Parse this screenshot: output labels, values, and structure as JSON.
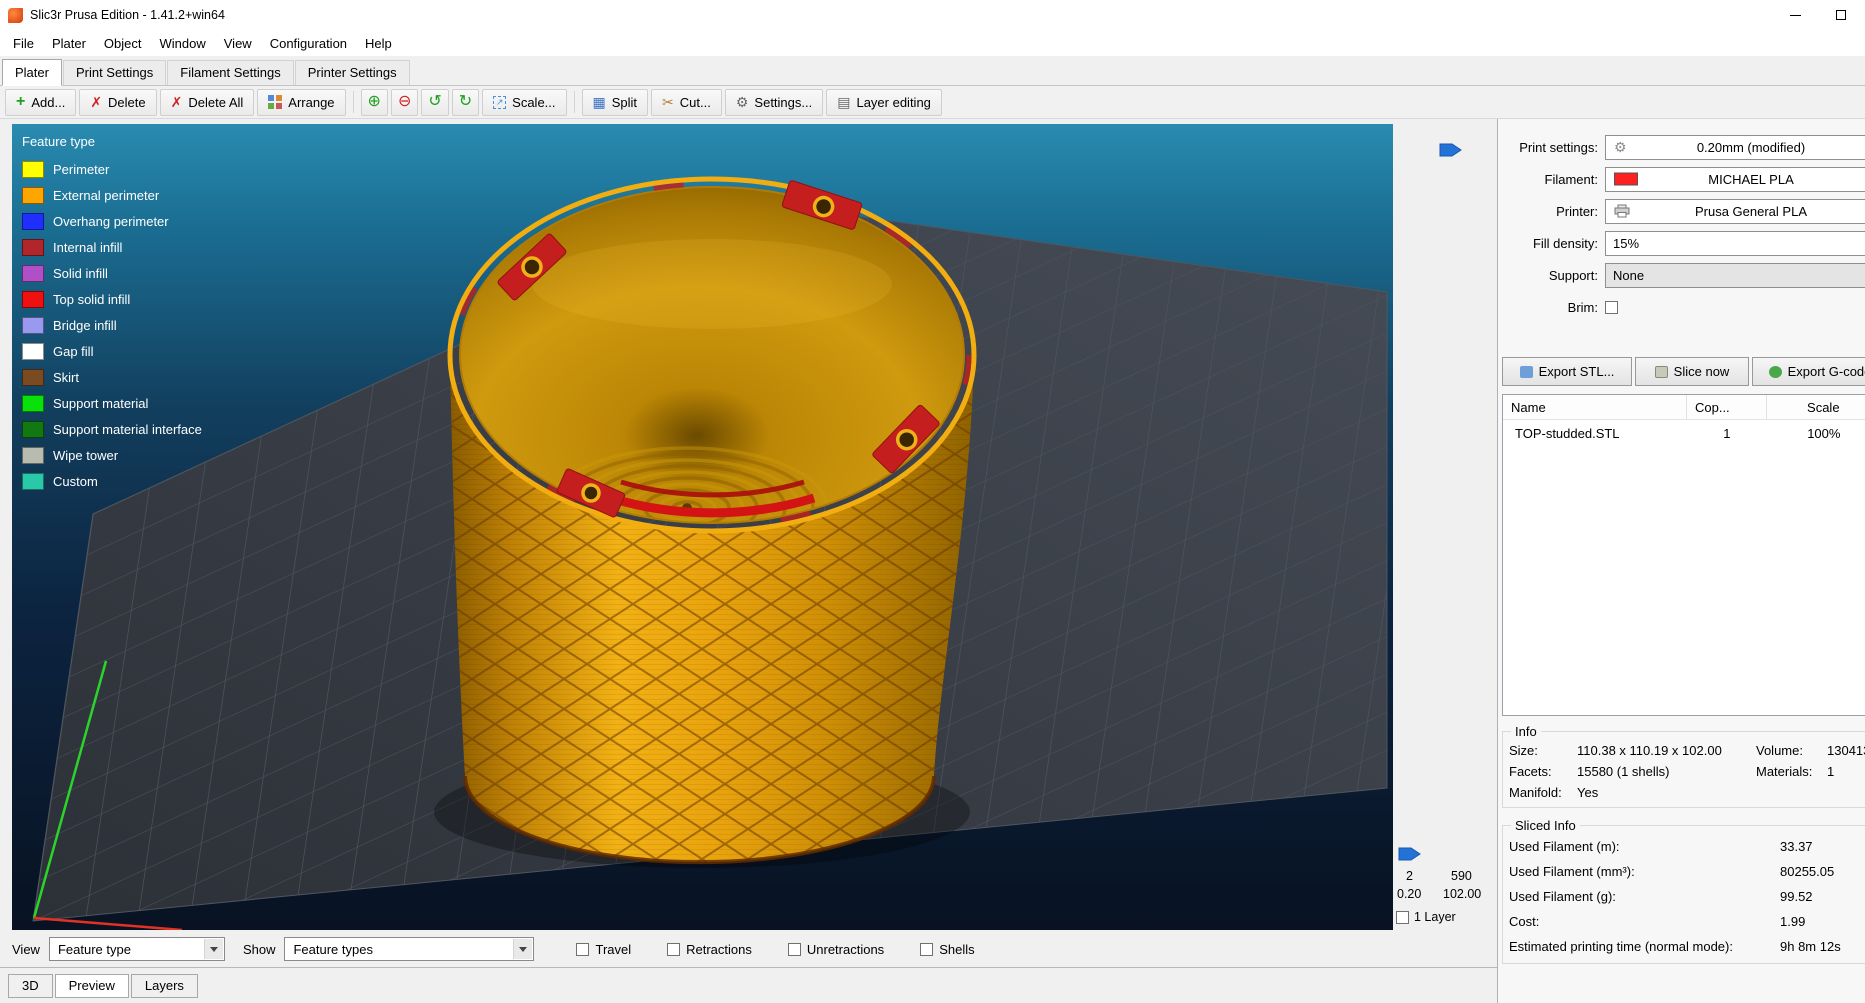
{
  "window": {
    "title": "Slic3r Prusa Edition - 1.41.2+win64"
  },
  "menubar": {
    "items": [
      "File",
      "Plater",
      "Object",
      "Window",
      "View",
      "Configuration",
      "Help"
    ]
  },
  "tabbar": {
    "items": [
      "Plater",
      "Print Settings",
      "Filament Settings",
      "Printer Settings"
    ],
    "active": "Plater"
  },
  "toolbar": {
    "add": "Add...",
    "delete": "Delete",
    "delete_all": "Delete All",
    "arrange": "Arrange",
    "scale": "Scale...",
    "split": "Split",
    "cut": "Cut...",
    "settings": "Settings...",
    "layer_editing": "Layer editing"
  },
  "icons": {
    "add_plus": "+",
    "delete_x": "✗",
    "add_instance": "⊕",
    "remove_instance": "⊖",
    "rotate_ccw": "↺",
    "rotate_cw": "↻",
    "scale_arrow": "↗",
    "split_grid": "▦",
    "cut_scissors": "✂",
    "gear": "⚙",
    "layers": "▤"
  },
  "legend": {
    "title": "Feature type",
    "items": [
      {
        "label": "Perimeter",
        "color": "#FFFF00"
      },
      {
        "label": "External perimeter",
        "color": "#FFA500"
      },
      {
        "label": "Overhang perimeter",
        "color": "#1F2FFF"
      },
      {
        "label": "Internal infill",
        "color": "#B0262B"
      },
      {
        "label": "Solid infill",
        "color": "#B050C8"
      },
      {
        "label": "Top solid infill",
        "color": "#F01010"
      },
      {
        "label": "Bridge infill",
        "color": "#9999F0"
      },
      {
        "label": "Gap fill",
        "color": "#FFFFFF"
      },
      {
        "label": "Skirt",
        "color": "#7A4B20"
      },
      {
        "label": "Support material",
        "color": "#0AE00A"
      },
      {
        "label": "Support material interface",
        "color": "#127812"
      },
      {
        "label": "Wipe tower",
        "color": "#B7BCAE"
      },
      {
        "label": "Custom",
        "color": "#28C8A8"
      }
    ]
  },
  "slider": {
    "min_layer": "2",
    "max_layer": "590",
    "min_z": "0.20",
    "max_z": "102.00",
    "one_layer_label": "1 Layer"
  },
  "sidebar": {
    "print_settings_label": "Print settings:",
    "print_settings_value": "0.20mm (modified)",
    "filament_label": "Filament:",
    "filament_value": "MICHAEL PLA",
    "filament_color": "#FF2020",
    "printer_label": "Printer:",
    "printer_value": "Prusa General PLA",
    "fill_density_label": "Fill density:",
    "fill_density_value": "15%",
    "support_label": "Support:",
    "support_value": "None",
    "brim_label": "Brim:",
    "export_stl": "Export STL...",
    "slice_now": "Slice now",
    "export_gcode": "Export G-code",
    "table": {
      "headers": [
        "Name",
        "Cop...",
        "Scale"
      ],
      "rows": [
        [
          "TOP-studded.STL",
          "1",
          "100%"
        ]
      ]
    },
    "info": {
      "legend": "Info",
      "size_label": "Size:",
      "size_value": "110.38 x 110.19 x 102.00",
      "volume_label": "Volume:",
      "volume_value": "130413",
      "facets_label": "Facets:",
      "facets_value": "15580 (1 shells)",
      "materials_label": "Materials:",
      "materials_value": "1",
      "manifold_label": "Manifold:",
      "manifold_value": "Yes"
    },
    "sliced_info": {
      "legend": "Sliced Info",
      "rows": [
        {
          "label": "Used Filament (m):",
          "value": "33.37"
        },
        {
          "label": "Used Filament (mm³):",
          "value": "80255.05"
        },
        {
          "label": "Used Filament (g):",
          "value": "99.52"
        },
        {
          "label": "Cost:",
          "value": "1.99"
        },
        {
          "label": "Estimated printing time (normal mode):",
          "value": "9h 8m 12s"
        }
      ]
    }
  },
  "bottombar": {
    "view_label": "View",
    "view_value": "Feature type",
    "show_label": "Show",
    "show_value": "Feature types",
    "checkboxes": [
      "Travel",
      "Retractions",
      "Unretractions",
      "Shells"
    ]
  },
  "bottom_tabs": {
    "items": [
      "3D",
      "Preview",
      "Layers"
    ],
    "active": "Preview"
  }
}
